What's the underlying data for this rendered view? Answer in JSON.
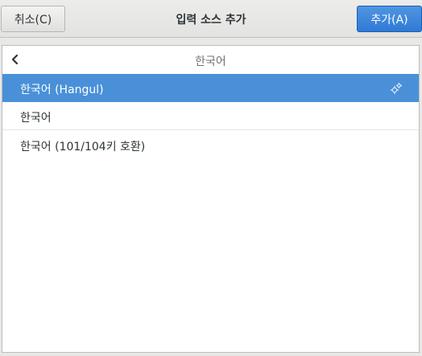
{
  "header": {
    "cancel_label": "취소(C)",
    "title": "입력 소스 추가",
    "add_label": "추가(A)"
  },
  "nav": {
    "label": "한국어"
  },
  "list": {
    "items": [
      {
        "label": "한국어 (Hangul)",
        "selected": true,
        "icon": "gear-icon"
      },
      {
        "label": "한국어",
        "selected": false
      },
      {
        "label": "한국어 (101/104키 호환)",
        "selected": false
      }
    ]
  },
  "colors": {
    "accent": "#4a90d9",
    "button_primary": "#3584e4"
  }
}
